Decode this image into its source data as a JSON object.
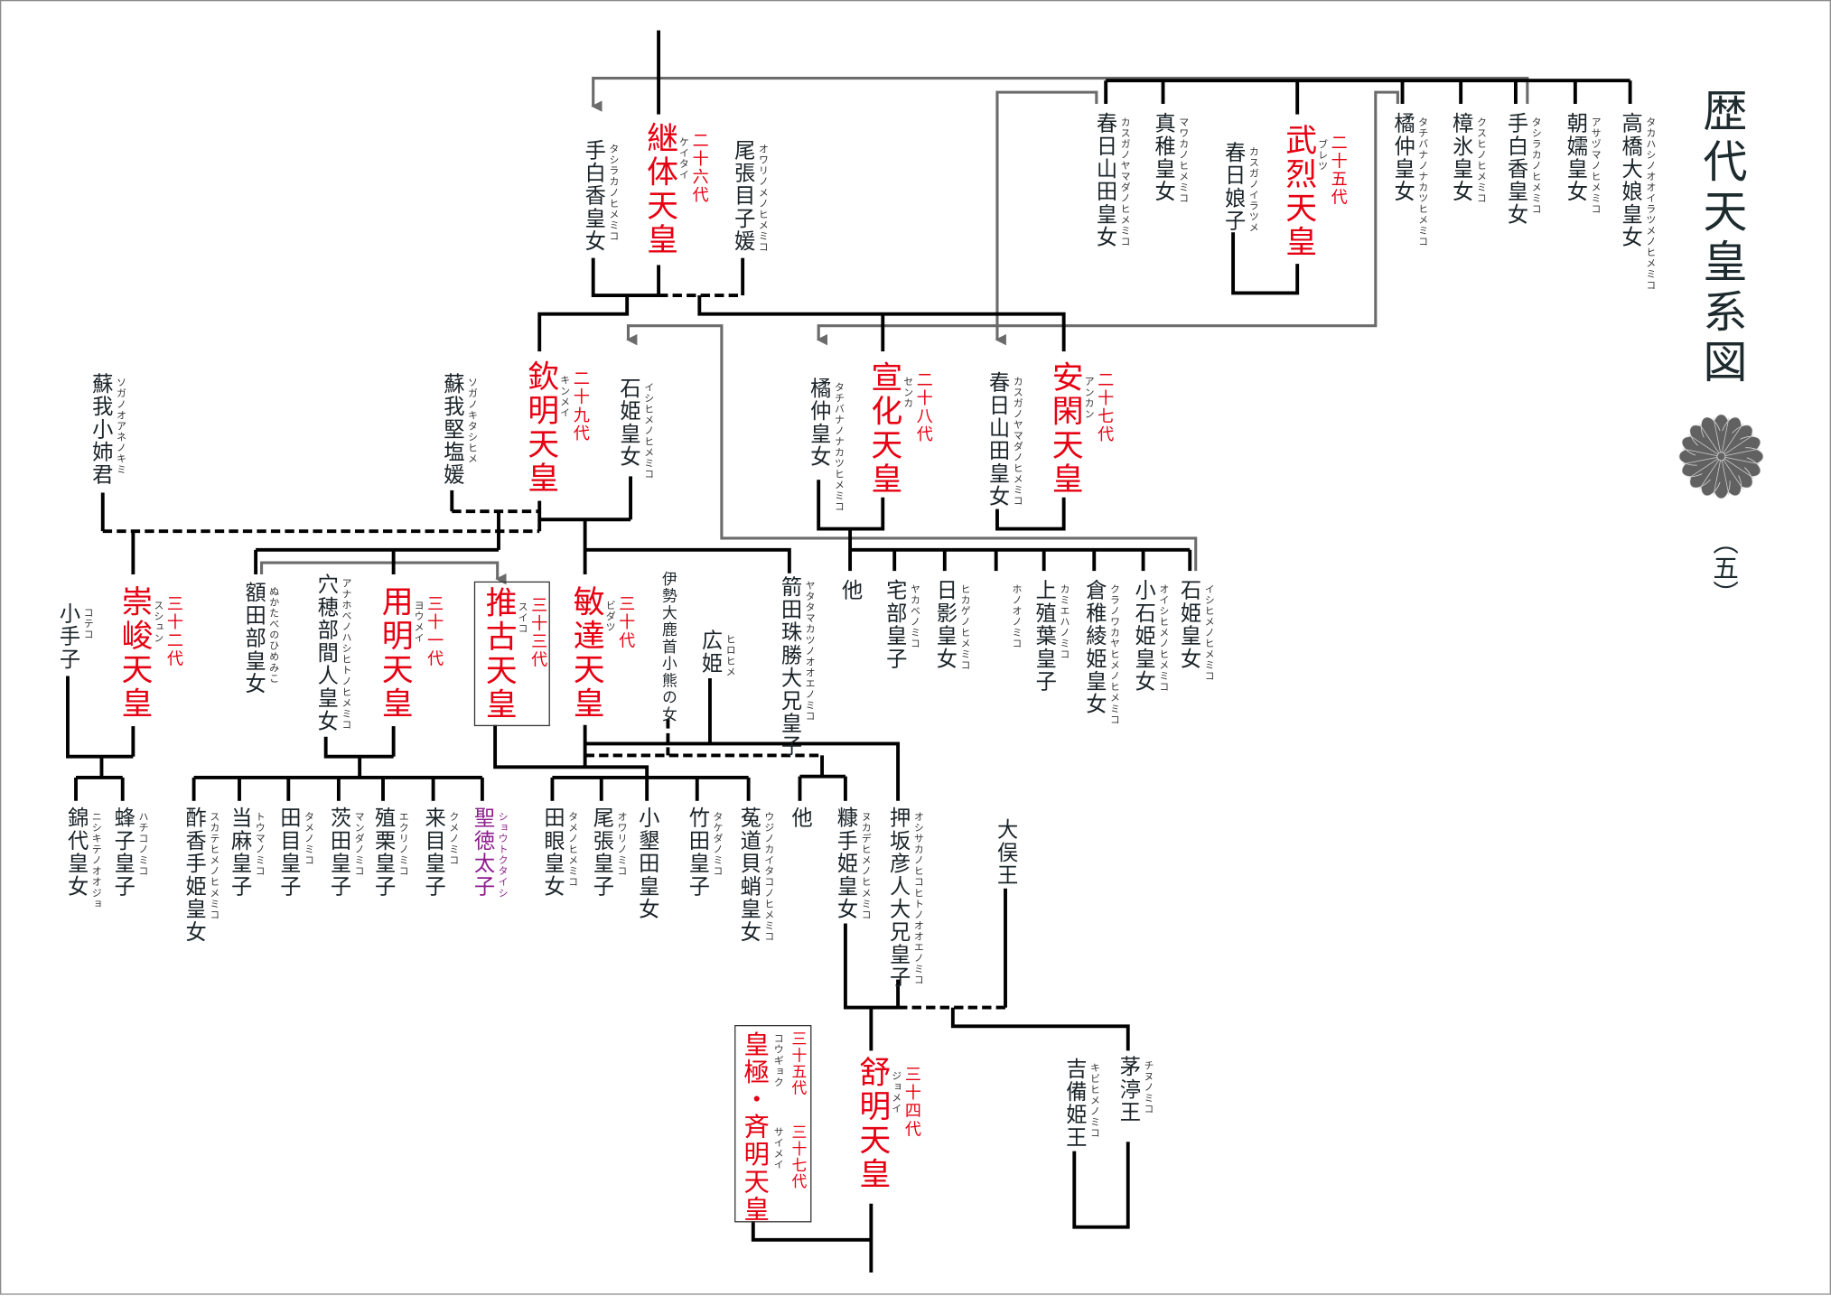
{
  "title": "歴代天皇系図",
  "volume": "（五）",
  "colors": {
    "emperor": "#e60012",
    "highlight": "#8e1b8e",
    "line": "#000000",
    "cross_line": "#6b6b6b",
    "crest": "#616161"
  },
  "crest_icon": "chrysanthemum-crest",
  "nodes": [
    {
      "name": "手白香皇女",
      "reading": "タシラカノヒメミコ"
    },
    {
      "name": "継体天皇",
      "reading": "ケイタイ",
      "generation": "二十六代",
      "emperor": true
    },
    {
      "name": "尾張目子媛",
      "reading": "オワリノメノヒメミコ"
    },
    {
      "name": "春日山田皇女",
      "reading": "カスガノヤマダノヒメミコ"
    },
    {
      "name": "真稚皇女",
      "reading": "マワカノヒメミコ"
    },
    {
      "name": "春日娘子",
      "reading": "カスガノイラツメ"
    },
    {
      "name": "武烈天皇",
      "reading": "ブレツ",
      "generation": "二十五代",
      "emperor": true
    },
    {
      "name": "橘仲皇女",
      "reading": "タチバナノナカツヒメミコ"
    },
    {
      "name": "樟氷皇女",
      "reading": "クスヒノヒメミコ"
    },
    {
      "name": "手白香皇女",
      "reading": "タシラカノヒメミコ"
    },
    {
      "name": "朝嬬皇女",
      "reading": "アサヅマノヒメミコ"
    },
    {
      "name": "高橋大娘皇女",
      "reading": "タカハシノオオイラツメノヒメミコ"
    },
    {
      "name": "蘇我小姉君",
      "reading": "ソガノオアネノキミ"
    },
    {
      "name": "蘇我堅塩媛",
      "reading": "ソガノキタシヒメ"
    },
    {
      "name": "欽明天皇",
      "reading": "キンメイ",
      "generation": "二十九代",
      "emperor": true
    },
    {
      "name": "石姫皇女",
      "reading": "イシヒメノヒメミコ"
    },
    {
      "name": "橘仲皇女",
      "reading": "タチバナノナカツヒメミコ"
    },
    {
      "name": "宣化天皇",
      "reading": "センカ",
      "generation": "二十八代",
      "emperor": true
    },
    {
      "name": "春日山田皇女",
      "reading": "カスガノヤマダノヒメミコ"
    },
    {
      "name": "安閑天皇",
      "reading": "アンカン",
      "generation": "二十七代",
      "emperor": true
    },
    {
      "name": "小手子",
      "reading": "コテコ"
    },
    {
      "name": "崇峻天皇",
      "reading": "スシュン",
      "generation": "三十二代",
      "emperor": true
    },
    {
      "name": "額田部皇女",
      "reading": "ぬかたべのひめみこ"
    },
    {
      "name": "穴穂部間人皇女",
      "reading": "アナホベノハシヒトノヒメミコ"
    },
    {
      "name": "用明天皇",
      "reading": "ヨウメイ",
      "generation": "三十一代",
      "emperor": true
    },
    {
      "name": "推古天皇",
      "reading": "スイコ",
      "generation": "三十三代",
      "emperor": true,
      "boxed": true
    },
    {
      "name": "敏達天皇",
      "reading": "ビダツ",
      "generation": "三十代",
      "emperor": true
    },
    {
      "name": "伊勢大鹿首小熊の女"
    },
    {
      "name": "広姫",
      "reading": "ヒロヒメ"
    },
    {
      "name": "箭田珠勝大兄皇子",
      "reading": "ヤタタマカツノオオエノミコ"
    },
    {
      "name": "他"
    },
    {
      "name": "宅部皇子",
      "reading": "ヤカベノミコ"
    },
    {
      "name": "日影皇女",
      "reading": "ヒカゲノヒメミコ"
    },
    {
      "reading": "ホノオノミコ"
    },
    {
      "name": "上殖葉皇子",
      "reading": "カミエハノミコ"
    },
    {
      "name": "倉稚綾姫皇女",
      "reading": "クラノワカヤヒメノヒメミコ"
    },
    {
      "name": "小石姫皇女",
      "reading": "オイシヒメノヒメミコ"
    },
    {
      "name": "石姫皇女",
      "reading": "イシヒメノヒメミコ"
    },
    {
      "name": "錦代皇女",
      "reading": "ニシキテノオオジョ"
    },
    {
      "name": "蜂子皇子",
      "reading": "ハチコノミコ"
    },
    {
      "name": "酢香手姫皇女",
      "reading": "スカテヒメノヒメミコ"
    },
    {
      "name": "当麻皇子",
      "reading": "トウマノミコ"
    },
    {
      "name": "田目皇子",
      "reading": "タメノミコ"
    },
    {
      "name": "茨田皇子",
      "reading": "マンダノミコ"
    },
    {
      "name": "殖栗皇子",
      "reading": "エクリノミコ"
    },
    {
      "name": "来目皇子",
      "reading": "クメノミコ"
    },
    {
      "name": "聖徳太子",
      "reading": "ショウトクタイシ",
      "highlight": true
    },
    {
      "name": "田眼皇女",
      "reading": "タメノヒメミコ"
    },
    {
      "name": "尾張皇子",
      "reading": "オワリノミコ"
    },
    {
      "name": "小墾田皇女"
    },
    {
      "name": "竹田皇子",
      "reading": "タケダノミコ"
    },
    {
      "name": "菟道貝蛸皇女",
      "reading": "ウジノカイタコノヒメミコ"
    },
    {
      "name": "他"
    },
    {
      "name": "糠手姫皇女",
      "reading": "ヌカデヒメノヒメミコ"
    },
    {
      "name": "押坂彦人大兄皇子",
      "reading": "オシサカノヒコヒトノオオエノミコ"
    },
    {
      "name": "大俣王"
    },
    {
      "name": "舒明天皇",
      "reading": "ジョメイ",
      "generation": "三十四代",
      "emperor": true
    },
    {
      "name": "茅渟王",
      "reading": "チヌノミコ"
    },
    {
      "name": "吉備姫王",
      "reading": "キビヒメノミコ"
    }
  ],
  "kogyoku_saimei": {
    "name": "皇極・斉明天皇",
    "reading_1": "コウギョク",
    "reading_2": "サイメイ",
    "generation_1": "三十五代",
    "generation_2": "三十七代"
  }
}
